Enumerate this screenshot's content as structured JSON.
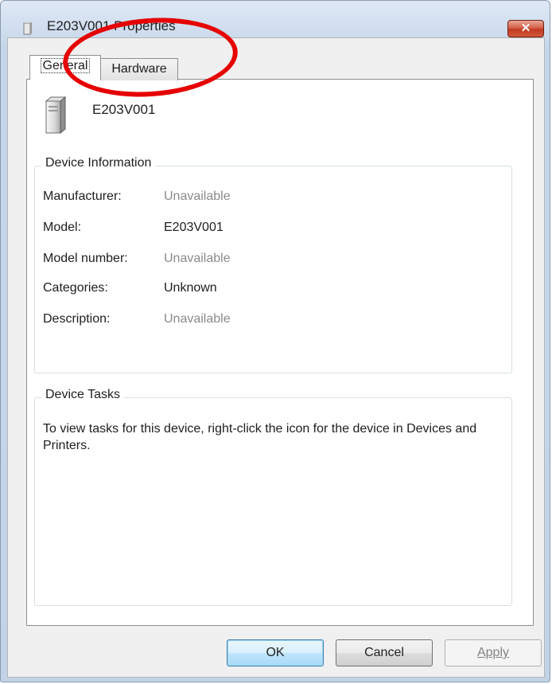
{
  "window": {
    "title": "E203V001 Properties",
    "close_label": "✕"
  },
  "tabs": [
    {
      "label": "General",
      "selected": true
    },
    {
      "label": "Hardware",
      "selected": false
    }
  ],
  "device": {
    "name": "E203V001"
  },
  "device_information": {
    "legend": "Device Information",
    "rows": [
      {
        "key": "Manufacturer:",
        "value": "Unavailable",
        "status": "gray"
      },
      {
        "key": "Model:",
        "value": "E203V001",
        "status": "dark"
      },
      {
        "key": "Model number:",
        "value": "Unavailable",
        "status": "gray"
      },
      {
        "key": "Categories:",
        "value": "Unknown",
        "status": "dark"
      },
      {
        "key": "Description:",
        "value": "Unavailable",
        "status": "gray"
      }
    ]
  },
  "device_tasks": {
    "legend": "Device Tasks",
    "text": "To view tasks for this device, right-click the icon for the device in Devices and Printers."
  },
  "buttons": {
    "ok": "OK",
    "cancel": "Cancel",
    "apply": "Apply",
    "apply_enabled": false
  },
  "annotation": {
    "shape": "ellipse",
    "color": "#e60000",
    "highlights": "Hardware tab"
  },
  "icons": {
    "title": "device-icon",
    "device": "tower-device-icon",
    "close": "close-icon"
  }
}
